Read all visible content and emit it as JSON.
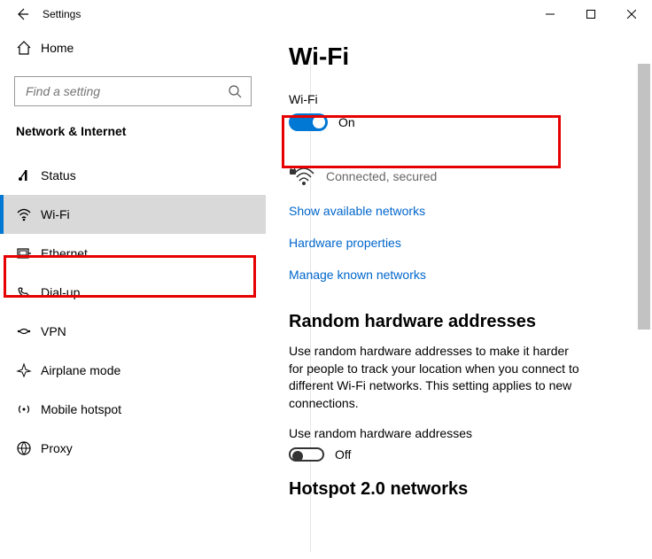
{
  "window": {
    "title": "Settings"
  },
  "sidebar": {
    "home_label": "Home",
    "search_placeholder": "Find a setting",
    "section_title": "Network & Internet",
    "items": [
      {
        "label": "Status"
      },
      {
        "label": "Wi-Fi"
      },
      {
        "label": "Ethernet"
      },
      {
        "label": "Dial-up"
      },
      {
        "label": "VPN"
      },
      {
        "label": "Airplane mode"
      },
      {
        "label": "Mobile hotspot"
      },
      {
        "label": "Proxy"
      }
    ]
  },
  "page": {
    "title": "Wi-Fi",
    "wifi_label": "Wi-Fi",
    "wifi_state_text": "On",
    "network_status": "Connected, secured",
    "links": {
      "show_networks": "Show available networks",
      "hardware_properties": "Hardware properties",
      "manage_known": "Manage known networks"
    },
    "random_hw": {
      "heading": "Random hardware addresses",
      "body": "Use random hardware addresses to make it harder for people to track your location when you connect to different Wi-Fi networks. This setting applies to new connections.",
      "toggle_label": "Use random hardware addresses",
      "toggle_state_text": "Off"
    },
    "hotspot_heading": "Hotspot 2.0 networks"
  }
}
